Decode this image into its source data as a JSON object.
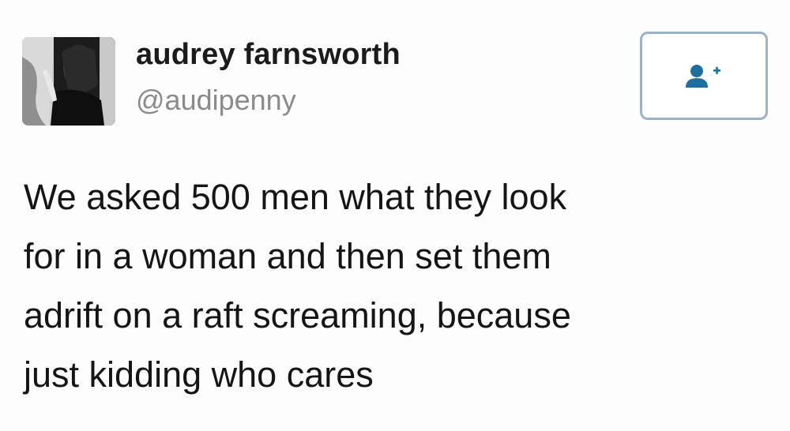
{
  "tweet": {
    "author": {
      "name": "audrey farnsworth",
      "handle": "@audipenny"
    },
    "follow_button_icon": "add-user-icon",
    "text": "We asked 500 men what they look\nfor in a woman and then set them\nadrift on a raft screaming, because\njust kidding who cares"
  },
  "colors": {
    "follow_border": "#9bb3c4",
    "follow_icon": "#1f6f9e",
    "handle": "#8a8a8a"
  }
}
